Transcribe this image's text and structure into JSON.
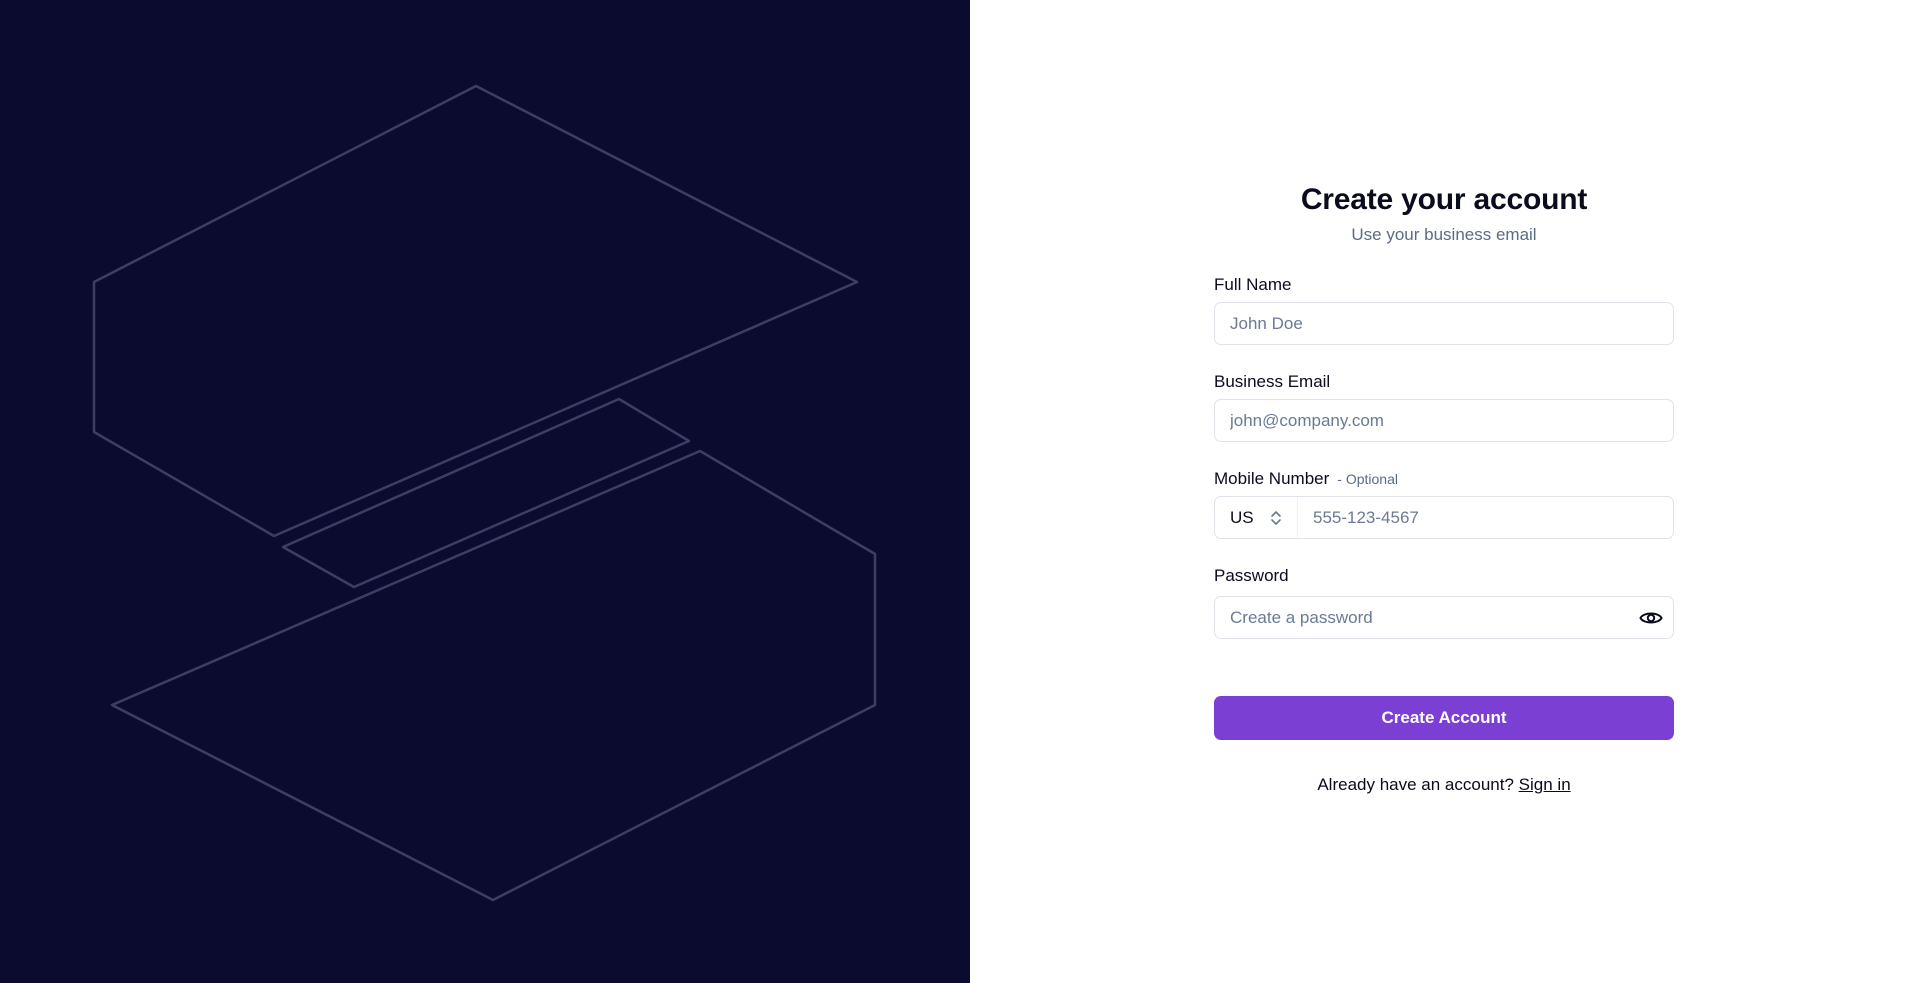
{
  "form": {
    "title": "Create your account",
    "subtitle": "Use your business email",
    "full_name": {
      "label": "Full Name",
      "placeholder": "John Doe",
      "value": ""
    },
    "business_email": {
      "label": "Business Email",
      "placeholder": "john@company.com",
      "value": ""
    },
    "mobile_number": {
      "label": "Mobile Number",
      "optional_note": "- Optional",
      "country_code": "US",
      "placeholder": "555-123-4567",
      "value": ""
    },
    "password": {
      "label": "Password",
      "placeholder": "Create a password",
      "value": "",
      "toggle_icon": "eye-icon"
    },
    "submit_label": "Create Account",
    "signin_prompt": "Already have an account?",
    "signin_link": "Sign in"
  },
  "colors": {
    "left_panel_bg": "#0b0b30",
    "outline_stroke": "#3d3e66",
    "button_bg": "#7b3fd4",
    "title_text": "#0b0b1e",
    "muted_text": "#5b6b86"
  }
}
